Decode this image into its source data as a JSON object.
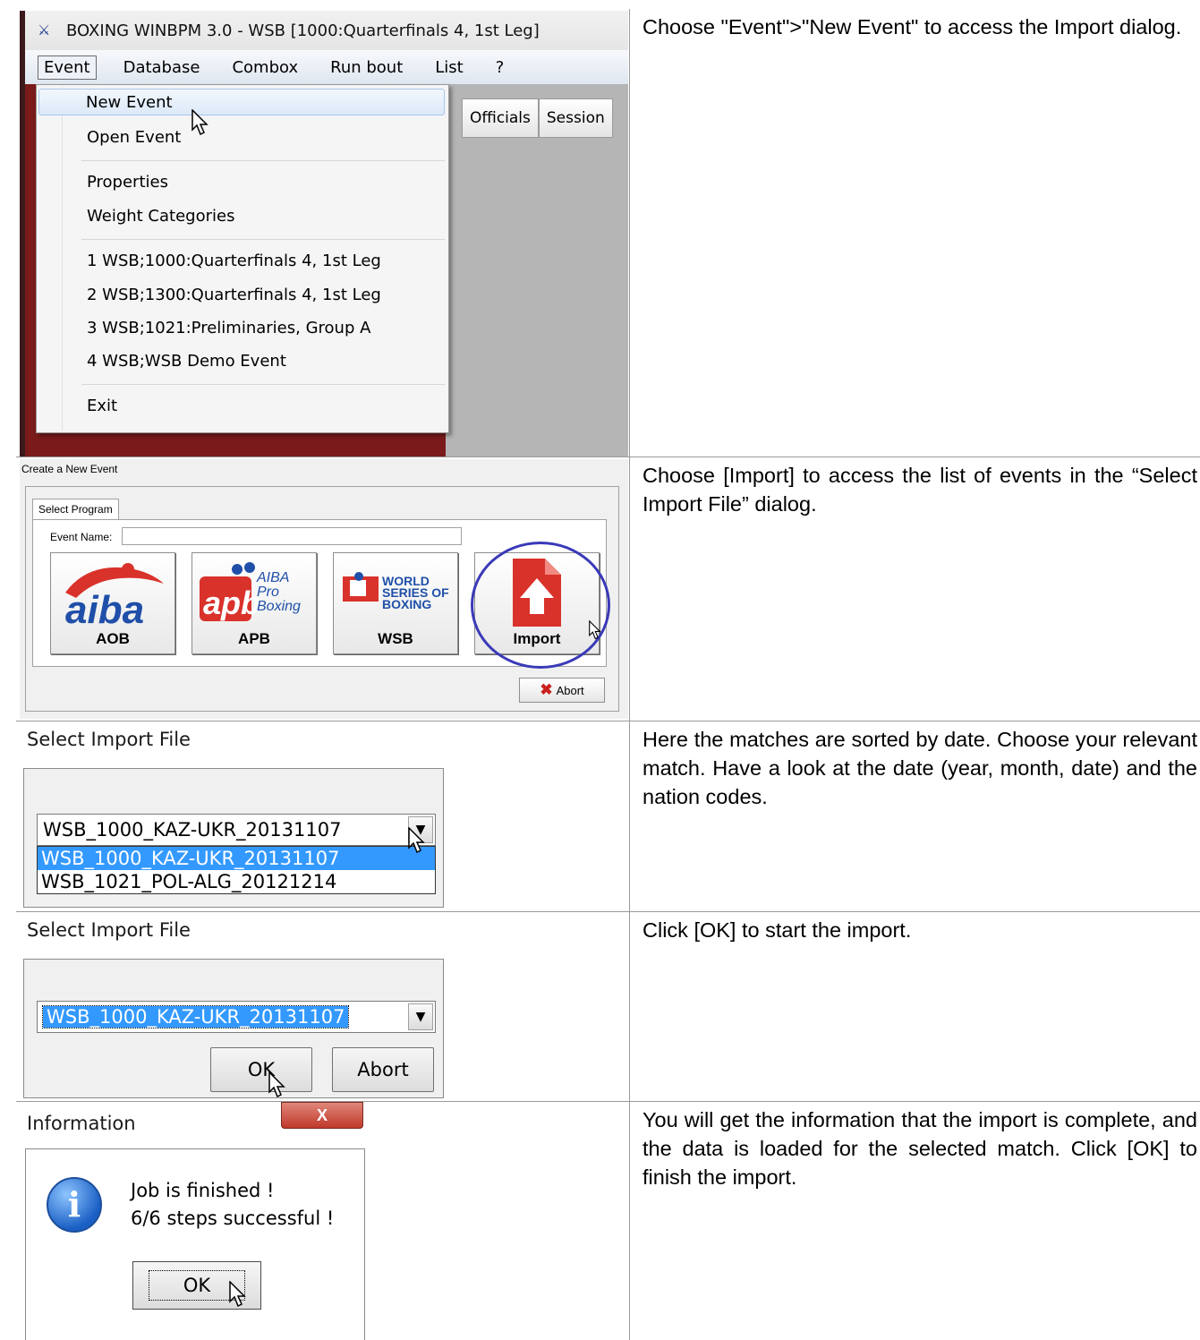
{
  "rows": [
    {
      "text": "Choose \"Event\">\"New Event\" to access the Import dialog.",
      "app": {
        "title": "BOXING WINBPM 3.0 - WSB [1000:Quarterfinals 4, 1st Leg]",
        "menu": [
          "Event",
          "Database",
          "Combox",
          "Run bout",
          "List",
          "?"
        ],
        "toolbar": [
          "Officials",
          "Session"
        ],
        "dropdown": {
          "new_event": "New Event",
          "open_event": "Open Event",
          "properties": "Properties",
          "weight_categories": "Weight Categories",
          "recent": [
            "1 WSB;1000:Quarterfinals 4, 1st Leg",
            "2 WSB;1300:Quarterfinals 4, 1st Leg",
            "3 WSB;1021:Preliminaries, Group A",
            "4 WSB;WSB Demo Event"
          ],
          "exit": "Exit"
        }
      }
    },
    {
      "text": "Choose [Import] to access the list of events in the “Select Import File” dialog.",
      "dialog": {
        "title": "Create a New Event",
        "tab": "Select Program",
        "event_name_label": "Event Name:",
        "buttons": [
          "AOB",
          "APB",
          "WSB",
          "Import"
        ],
        "aob_logo": "aiba",
        "apb_logo": "apb",
        "apb_logo_text": [
          "AIBA",
          "Pro",
          "Boxing"
        ],
        "wsb_logo_text": [
          "WORLD",
          "SERIES OF",
          "BOXING"
        ],
        "abort": "Abort"
      }
    },
    {
      "text": "Here the matches are sorted by date. Choose your relevant match. Have a look at the date (year, month, date) and the nation codes.",
      "dialog": {
        "title": "Select Import File",
        "combo_value": "WSB_1000_KAZ-UKR_20131107",
        "options": [
          "WSB_1000_KAZ-UKR_20131107",
          "WSB_1021_POL-ALG_20121214"
        ]
      }
    },
    {
      "text": "Click [OK] to start the import.",
      "dialog": {
        "title": "Select Import File",
        "combo_value": "WSB_1000_KAZ-UKR_20131107",
        "ok": "OK",
        "abort": "Abort"
      }
    },
    {
      "text": "You will get the information that the import is complete, and the data is loaded for the selected match. Click [OK] to finish the import.",
      "dialog": {
        "title": "Information",
        "close": "X",
        "line1": "Job is finished !",
        "line2": "6/6 steps successful !",
        "ok": "OK"
      }
    }
  ],
  "icons": {
    "app_logo": "boxing-logo-icon",
    "info": "information-icon",
    "abort": "red-x-icon",
    "import": "import-file-icon"
  },
  "colors": {
    "selection": "#3399ff",
    "highlight_circle": "#3a3ab8",
    "import_red": "#d9322b"
  }
}
